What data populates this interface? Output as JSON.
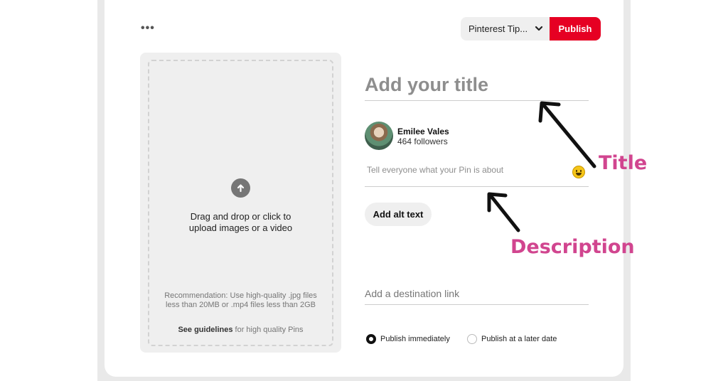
{
  "toolbar": {
    "more_label": "•••",
    "board": "Pinterest Tip...",
    "publish": "Publish"
  },
  "upload": {
    "prompt_line1": "Drag and drop or click to",
    "prompt_line2": "upload images or a video",
    "recommendation": "Recommendation: Use high-quality .jpg files less than 20MB or .mp4 files less than 2GB",
    "guidelines_link": "See guidelines",
    "guidelines_rest": " for high quality Pins"
  },
  "form": {
    "title_placeholder": "Add your title",
    "user_name": "Emilee Vales",
    "followers": "464 followers",
    "description_placeholder": "Tell everyone what your Pin is about",
    "alt_text_button": "Add alt text",
    "destination_placeholder": "Add a destination link",
    "publish_now": "Publish immediately",
    "publish_later": "Publish at a later date"
  },
  "annotations": {
    "title": "Title",
    "description": "Description"
  },
  "colors": {
    "publish_red": "#e60023",
    "annotation_pink": "#d1458f"
  }
}
